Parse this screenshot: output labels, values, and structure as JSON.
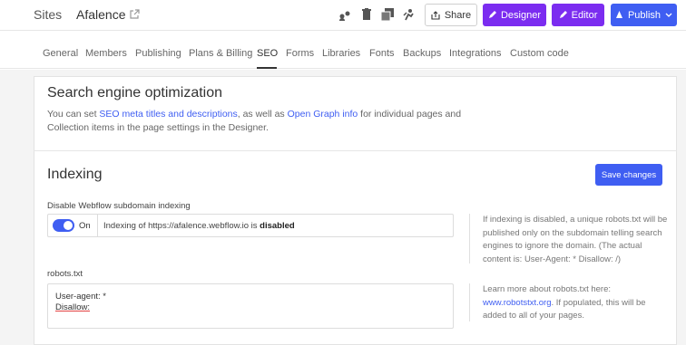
{
  "header": {
    "sites": "Sites",
    "site_name": "Afalence",
    "share": "Share",
    "designer": "Designer",
    "editor": "Editor",
    "publish": "Publish"
  },
  "tabs": [
    "General",
    "Members",
    "Publishing",
    "Plans & Billing",
    "SEO",
    "Forms",
    "Libraries",
    "Fonts",
    "Backups",
    "Integrations",
    "Custom code"
  ],
  "seo": {
    "title": "Search engine optimization",
    "desc_pre": "You can set ",
    "link1": "SEO meta titles and descriptions",
    "desc_mid": ", as well as ",
    "link2": "Open Graph info",
    "desc_post": " for individual pages and Collection items in the page settings in the Designer."
  },
  "indexing": {
    "title": "Indexing",
    "save": "Save changes",
    "disable_label": "Disable Webflow subdomain indexing",
    "toggle_on": "On",
    "status_pre": "Indexing of https://afalence.webflow.io is ",
    "status_bold": "disabled",
    "note1": "If indexing is disabled, a unique robots.txt will be published only on the subdomain telling search engines to ignore the domain. (The actual content is: User-Agent: * Disallow: /)",
    "robots_label": "robots.txt",
    "robots_line1": "User-agent: *",
    "robots_line2": "Disallow:",
    "note2_pre": "Learn more about robots.txt here: ",
    "note2_link": "www.robotstxt.org",
    "note2_post": ". If populated, this will be added to all of your pages."
  }
}
